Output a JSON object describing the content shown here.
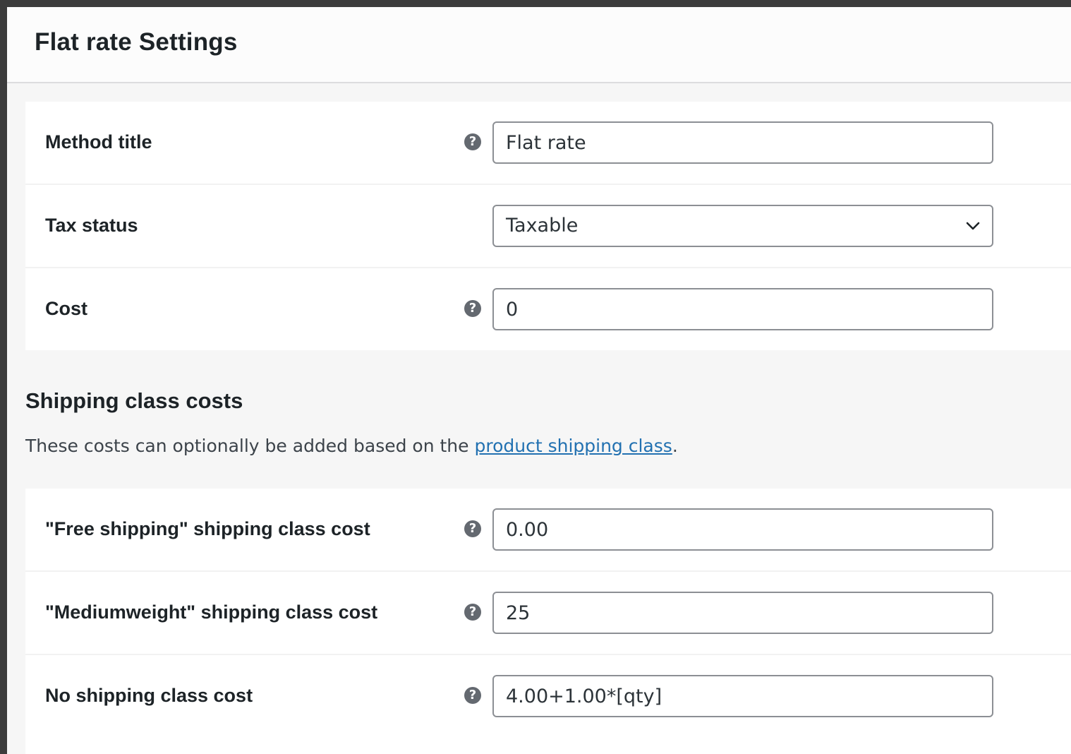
{
  "modal": {
    "title": "Flat rate Settings"
  },
  "general": {
    "method_title": {
      "label": "Method title",
      "value": "Flat rate",
      "help_icon": "question-circle-icon"
    },
    "tax_status": {
      "label": "Tax status",
      "selected": "Taxable",
      "icon": "chevron-down-icon"
    },
    "cost": {
      "label": "Cost",
      "value": "0",
      "help_icon": "question-circle-icon"
    }
  },
  "shipping_class_section": {
    "heading": "Shipping class costs",
    "description_before": "These costs can optionally be added based on the ",
    "link_text": "product shipping class",
    "description_after": "."
  },
  "class_costs": {
    "free_shipping": {
      "label": "\"Free shipping\" shipping class cost",
      "value": "0.00"
    },
    "mediumweight": {
      "label": "\"Mediumweight\" shipping class cost",
      "value": "25"
    },
    "no_class": {
      "label": "No shipping class cost",
      "value": "4.00+1.00*[qty]"
    }
  },
  "colors": {
    "link": "#2271b1",
    "help_icon_bg": "#646970",
    "field_border": "#8c8f94"
  }
}
